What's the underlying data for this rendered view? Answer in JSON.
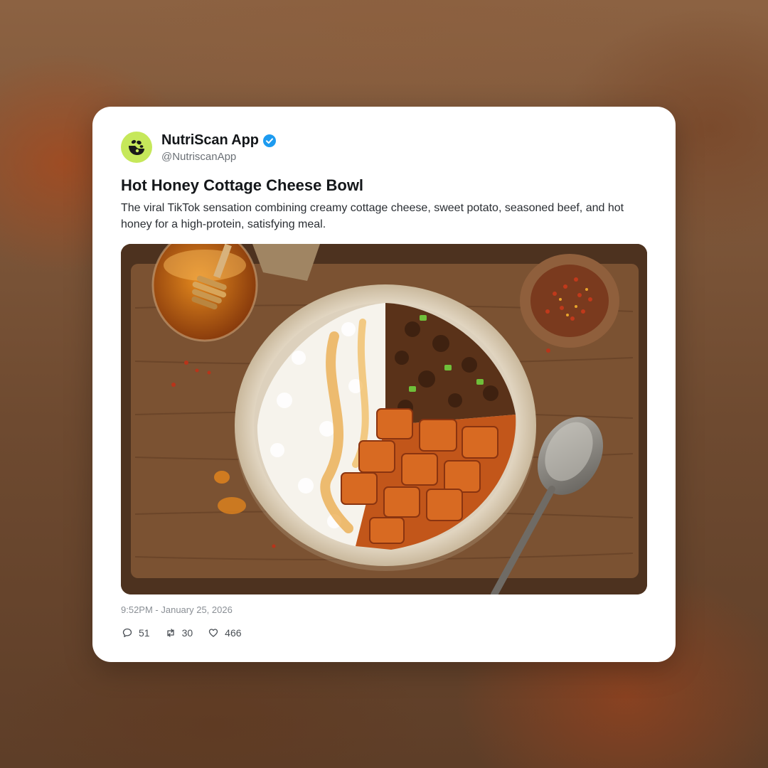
{
  "post": {
    "author": {
      "display_name": "NutriScan App",
      "handle": "@NutriscanApp",
      "verified": true,
      "avatar_color": "#c6e85a",
      "avatar_icon": "nutriscan-logo-icon"
    },
    "title": "Hot Honey Cottage Cheese Bowl",
    "body": "The viral TikTok sensation combining creamy cottage cheese, sweet potato, seasoned beef, and hot honey for a high-protein, satisfying meal.",
    "timestamp": "9:52PM - January 25, 2026",
    "actions": {
      "replies": {
        "icon": "reply-icon",
        "count": "51"
      },
      "retweets": {
        "icon": "retweet-icon",
        "count": "30"
      },
      "likes": {
        "icon": "heart-icon",
        "count": "466"
      }
    }
  },
  "colors": {
    "verified_badge": "#1d9bf0",
    "card_background": "#ffffff"
  }
}
